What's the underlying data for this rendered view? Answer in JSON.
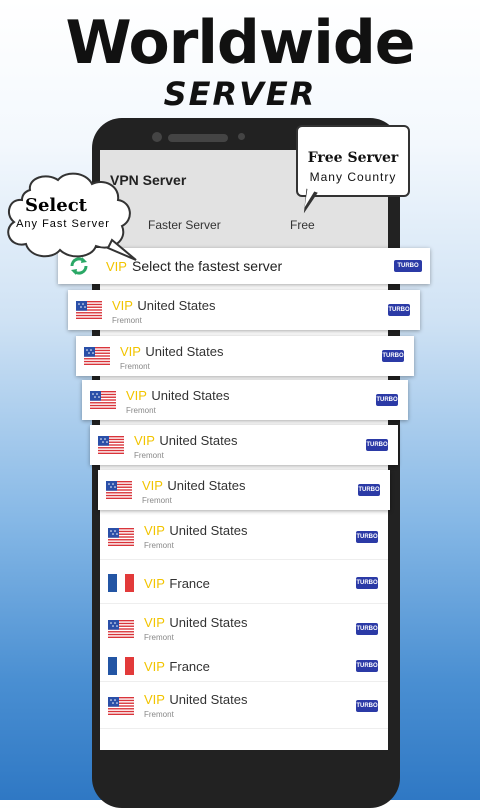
{
  "banner": {
    "title": "Worldwide",
    "subtitle": "SERVER"
  },
  "app": {
    "title": "VPN Server",
    "tabs": [
      "Faster Server",
      "Free"
    ]
  },
  "bubble_free": {
    "line1": "Free Server",
    "line2": "Many Country"
  },
  "bubble_select": {
    "line1": "Select",
    "line2": "Any Fast Server"
  },
  "fastest": {
    "prefix": "VIP",
    "label": "Select the fastest server",
    "badge": "TURBO"
  },
  "servers": [
    {
      "vip": "VIP",
      "country": "United States",
      "city": "Fremont",
      "badge": "TURBO",
      "flag": "us-flag"
    },
    {
      "vip": "VIP",
      "country": "United States",
      "city": "Fremont",
      "badge": "TURBO",
      "flag": "us-flag"
    },
    {
      "vip": "VIP",
      "country": "United States",
      "city": "Fremont",
      "badge": "TURBO",
      "flag": "us-flag"
    },
    {
      "vip": "VIP",
      "country": "United States",
      "city": "Fremont",
      "badge": "TURBO",
      "flag": "us-flag"
    },
    {
      "vip": "VIP",
      "country": "United States",
      "city": "Fremont",
      "badge": "TURBO",
      "flag": "us-flag"
    },
    {
      "vip": "VIP",
      "country": "United States",
      "city": "Fremont",
      "badge": "TURBO",
      "flag": "us-flag"
    },
    {
      "vip": "VIP",
      "country": "France",
      "city": "",
      "badge": "TURBO",
      "flag": "fr-flag"
    },
    {
      "vip": "VIP",
      "country": "United States",
      "city": "Fremont",
      "badge": "TURBO",
      "flag": "us-flag"
    },
    {
      "vip": "VIP",
      "country": "France",
      "city": "",
      "badge": "TURBO",
      "flag": "fr-flag"
    },
    {
      "vip": "VIP",
      "country": "United States",
      "city": "Fremont",
      "badge": "TURBO",
      "flag": "us-flag"
    }
  ],
  "colors": {
    "vip": "#f2c400",
    "turbo": "#2b3aa6",
    "us_red": "#d9343a",
    "us_blue": "#2a4fa8",
    "fr_blue": "#2355a4",
    "fr_red": "#e23a3a",
    "refresh": "#2aa866"
  }
}
